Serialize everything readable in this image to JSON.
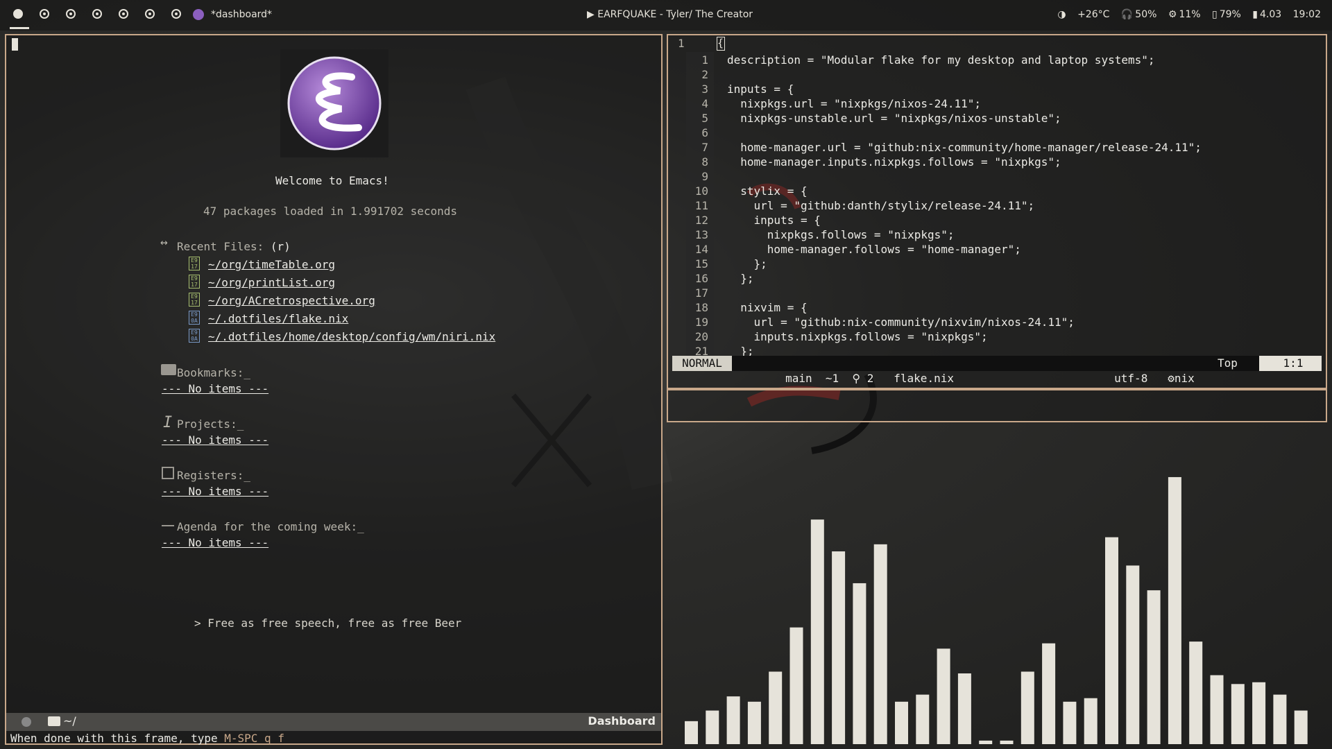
{
  "topbar": {
    "workspaces": [
      {
        "name": "workspace-1",
        "active": true
      },
      {
        "name": "workspace-2",
        "active": false
      },
      {
        "name": "workspace-3",
        "active": false
      },
      {
        "name": "workspace-4",
        "active": false
      },
      {
        "name": "workspace-5",
        "active": false
      },
      {
        "name": "workspace-6",
        "active": false
      },
      {
        "name": "workspace-7",
        "active": false
      }
    ],
    "window_title": "*dashboard*",
    "media": "▶  EARFQUAKE - Tyler/ The Creator",
    "status": {
      "temperature": "+26°C",
      "headphones": "50%",
      "cpu": "11%",
      "memory": "79%",
      "load": "4.03",
      "clock": "19:02"
    }
  },
  "dashboard": {
    "welcome": "Welcome to Emacs!",
    "packages": "47 packages loaded in 1.991702 seconds",
    "recent_files": {
      "title": "Recent Files: ",
      "key": "(r)",
      "items": [
        "~/org/timeTable.org",
        "~/org/printList.org",
        "~/org/ACretrospective.org",
        "~/.dotfiles/flake.nix",
        "~/.dotfiles/home/desktop/config/wm/niri.nix"
      ]
    },
    "bookmarks": {
      "title": "Bookmarks:_",
      "empty": "--- No items ---"
    },
    "projects": {
      "title": "Projects:_",
      "empty": "--- No items ---"
    },
    "registers": {
      "title": "Registers:_",
      "empty": "--- No items ---"
    },
    "agenda": {
      "title": "Agenda for the coming week:_",
      "empty": "--- No items ---"
    },
    "quote": "> Free as free speech, free as free Beer"
  },
  "left_modeline": {
    "directory": "~/",
    "buffer": "Dashboard"
  },
  "echo_area": {
    "text": "When done with this frame, type ",
    "keys": "M-SPC q f"
  },
  "editor": {
    "tab_number": "1",
    "lines": [
      {
        "n": "1",
        "text": "description = \"Modular flake for my desktop and laptop systems\";"
      },
      {
        "n": "2",
        "text": ""
      },
      {
        "n": "3",
        "text": "inputs = {"
      },
      {
        "n": "4",
        "text": "  nixpkgs.url = \"nixpkgs/nixos-24.11\";"
      },
      {
        "n": "5",
        "text": "  nixpkgs-unstable.url = \"nixpkgs/nixos-unstable\";"
      },
      {
        "n": "6",
        "text": ""
      },
      {
        "n": "7",
        "text": "  home-manager.url = \"github:nix-community/home-manager/release-24.11\";"
      },
      {
        "n": "8",
        "text": "  home-manager.inputs.nixpkgs.follows = \"nixpkgs\";"
      },
      {
        "n": "9",
        "text": ""
      },
      {
        "n": "10",
        "text": "  stylix = {"
      },
      {
        "n": "11",
        "text": "    url = \"github:danth/stylix/release-24.11\";"
      },
      {
        "n": "12",
        "text": "    inputs = {"
      },
      {
        "n": "13",
        "text": "      nixpkgs.follows = \"nixpkgs\";"
      },
      {
        "n": "14",
        "text": "      home-manager.follows = \"home-manager\";"
      },
      {
        "n": "15",
        "text": "    };"
      },
      {
        "n": "16",
        "text": "  };"
      },
      {
        "n": "17",
        "text": ""
      },
      {
        "n": "18",
        "text": "  nixvim = {"
      },
      {
        "n": "19",
        "text": "    url = \"github:nix-community/nixvim/nixos-24.11\";"
      },
      {
        "n": "20",
        "text": "    inputs.nixpkgs.follows = \"nixpkgs\";"
      },
      {
        "n": "21",
        "text": "  };"
      }
    ],
    "modeline": {
      "mode": "NORMAL",
      "segments": "  main  ~1  ⚲ 2   flake.nix                        utf-8   ⚙nix  ",
      "top": "Top",
      "position": "1:1"
    }
  },
  "visualizer": {
    "bar_color": "#e6e3da",
    "levels": [
      0.065,
      0.095,
      0.135,
      0.12,
      0.205,
      0.33,
      0.635,
      0.545,
      0.455,
      0.565,
      0.12,
      0.14,
      0.27,
      0.2,
      0.01,
      0.01,
      0.205,
      0.285,
      0.12,
      0.13,
      0.585,
      0.505,
      0.435,
      0.755,
      0.29,
      0.195,
      0.17,
      0.175,
      0.14,
      0.095
    ]
  }
}
